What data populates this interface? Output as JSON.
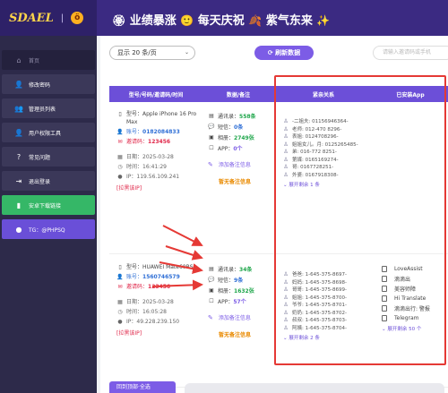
{
  "header": {
    "logo_text": "SDAEL",
    "logo_badge": "ö",
    "slogan": [
      {
        "icon": "🏵",
        "text": "业绩暴涨"
      },
      {
        "icon": "🙂",
        "text": "每天庆祝"
      },
      {
        "icon": "🍂",
        "text": "紫气东来"
      },
      {
        "icon": "✨",
        "text": ""
      }
    ]
  },
  "sidebar": {
    "items": [
      {
        "label": "首页",
        "icon": "home-icon",
        "glyph": "⌂"
      },
      {
        "label": "修改密码",
        "icon": "user-key-icon",
        "glyph": "👤"
      },
      {
        "label": "管理员列表",
        "icon": "admins-icon",
        "glyph": "👥"
      },
      {
        "label": "用户权限工具",
        "icon": "user-perm-icon",
        "glyph": "👤"
      },
      {
        "label": "常见问题",
        "icon": "question-icon",
        "glyph": "?"
      },
      {
        "label": "退出登录",
        "icon": "logout-icon",
        "glyph": "⇥"
      },
      {
        "label": "安卓下载链接",
        "icon": "android-icon",
        "glyph": "▮"
      },
      {
        "label": "TG：@PHPSQ",
        "icon": "telegram-icon",
        "glyph": "●"
      }
    ]
  },
  "toolbar": {
    "page_size": "显示 20 条/页",
    "refresh_label": "刷新数据",
    "export_placeholder": "请输入邀请码或手机"
  },
  "table": {
    "headers": [
      "型号/号码/邀请码/时间",
      "数据/备注",
      "紧亲关系",
      "已安装App"
    ],
    "rows": [
      {
        "model": "型号：Apple iPhone 16 Pro Max",
        "account_label": "账号：",
        "account": "0182084833",
        "invite_label": "邀请码：",
        "invite": "123456",
        "date": "日期：2025-03-28",
        "time": "时间：16:41:29",
        "ip": "IP：119.56.109.241",
        "action": "[拉黑该IP]",
        "stats": {
          "contacts_label": "通讯录：",
          "contacts": "558条",
          "sms_label": "短信：",
          "sms": "0条",
          "photos_label": "相册：",
          "photos": "2749张",
          "app_label": "APP：",
          "app": "0个"
        },
        "add_note": "添加备注信息",
        "note": "暂无备注信息",
        "relations": [
          "-二姐夫: 01156946364-",
          "老师: 012-470 8296-",
          "表姐: 0124708296-",
          "姐姐女儿。月: 0125265485-",
          "弟: 016-772 8251-",
          "第媒: 0165169274-",
          "哥: 0167728251-",
          "外婆: 0167918308-"
        ],
        "expand": "展开剩余 1 条",
        "apps": [],
        "apps_expand": ""
      },
      {
        "model": "型号：HUAWEI Mate60RS",
        "account_label": "账号：",
        "account": "1560746579",
        "invite_label": "邀请码：",
        "invite": "123456",
        "date": "日期：2025-03-28",
        "time": "时间：16:05:28",
        "ip": "IP：49.228.239.150",
        "action": "[拉黑该IP]",
        "stats": {
          "contacts_label": "通讯录：",
          "contacts": "34条",
          "sms_label": "短信：",
          "sms": "9条",
          "photos_label": "相册：",
          "photos": "1632张",
          "app_label": "APP：",
          "app": "57个"
        },
        "add_note": "添加备注信息",
        "note": "暂无备注信息",
        "relations": [
          "爸爸: 1-645-375-8697-",
          "妈妈: 1-645-375-8698-",
          "哥哥: 1-645-375-8699-",
          "姐姐: 1-645-375-8700-",
          "爷爷: 1-645-375-8701-",
          "奶奶: 1-645-375-8702-",
          "叔叔: 1-645-375-8703-",
          "阿姨: 1-645-375-8704-"
        ],
        "expand": "展开剩余 2 条",
        "apps": [
          "LoveAssist",
          "滴滴出",
          "美容师障",
          "Hi Translate",
          "滴滴出行: 警报",
          "Telegram"
        ],
        "apps_expand": "展开剩余 50 个"
      }
    ]
  },
  "footer": {
    "label": "回到顶部·全选"
  }
}
